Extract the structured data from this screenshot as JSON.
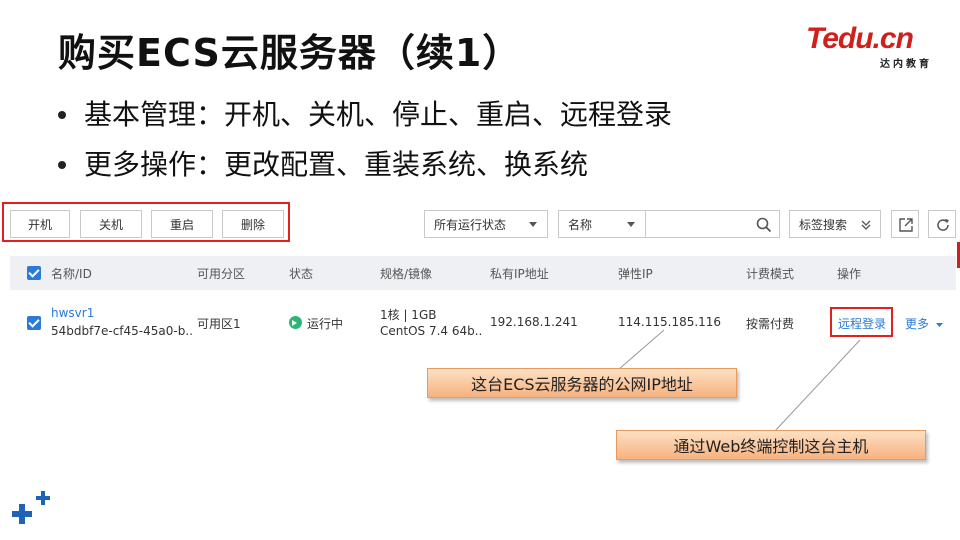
{
  "slide": {
    "title": "购买ECS云服务器（续1）",
    "bullets": [
      "基本管理：开机、关机、停止、重启、远程登录",
      "更多操作：更改配置、重装系统、换系统"
    ]
  },
  "logo": {
    "main": "Tedu.cn",
    "sub": "达内教育",
    "color": "#d0201e"
  },
  "toolbar": {
    "buttons": [
      "开机",
      "关机",
      "重启",
      "删除"
    ],
    "status_filter": "所有运行状态",
    "search_field": "名称",
    "search_value": "",
    "tag_search": "标签搜索"
  },
  "table": {
    "columns": [
      "名称/ID",
      "可用分区",
      "状态",
      "规格/镜像",
      "私有IP地址",
      "弹性IP",
      "计费模式",
      "操作"
    ],
    "rows": [
      {
        "name": "hwsvr1",
        "id": "54bdbf7e-cf45-45a0-b..",
        "zone": "可用区1",
        "status": "运行中",
        "spec": "1核 | 1GB",
        "image": "CentOS 7.4 64b..",
        "private_ip": "192.168.1.241",
        "eip": "114.115.185.116",
        "billing": "按需付费",
        "action_remote": "远程登录",
        "action_more": "更多"
      }
    ]
  },
  "callouts": {
    "public_ip": "这台ECS云服务器的公网IP地址",
    "remote_login": "通过Web终端控制这台主机"
  },
  "colors": {
    "accent_red": "#e0211f",
    "link_blue": "#2a7ad6",
    "status_green": "#2bb673",
    "callout_orange": "#f7b27e"
  }
}
